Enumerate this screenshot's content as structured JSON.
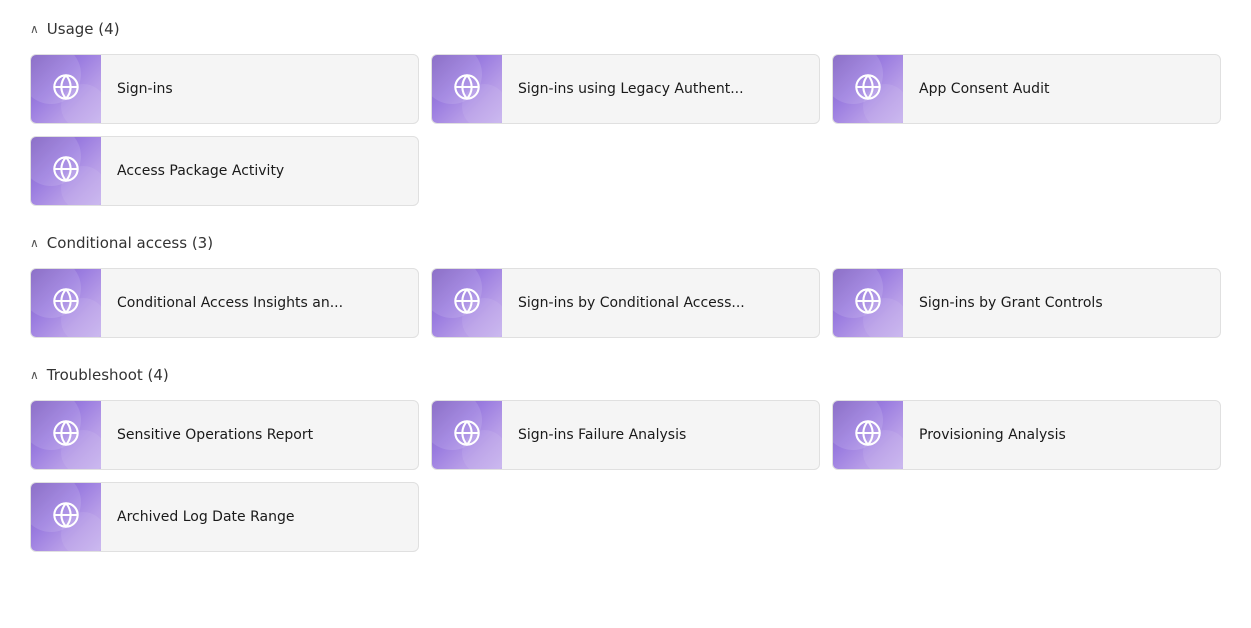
{
  "sections": [
    {
      "id": "usage",
      "label": "Usage (4)",
      "expanded": true,
      "cards": [
        {
          "id": "sign-ins",
          "label": "Sign-ins"
        },
        {
          "id": "sign-ins-legacy",
          "label": "Sign-ins using Legacy Authent..."
        },
        {
          "id": "app-consent-audit",
          "label": "App Consent Audit"
        },
        {
          "id": "access-package-activity",
          "label": "Access Package Activity"
        }
      ]
    },
    {
      "id": "conditional-access",
      "label": "Conditional access (3)",
      "expanded": true,
      "cards": [
        {
          "id": "conditional-access-insights",
          "label": "Conditional Access Insights an..."
        },
        {
          "id": "sign-ins-by-conditional-access",
          "label": "Sign-ins by Conditional Access..."
        },
        {
          "id": "sign-ins-by-grant-controls",
          "label": "Sign-ins by Grant Controls"
        }
      ]
    },
    {
      "id": "troubleshoot",
      "label": "Troubleshoot (4)",
      "expanded": true,
      "cards": [
        {
          "id": "sensitive-operations-report",
          "label": "Sensitive Operations Report"
        },
        {
          "id": "sign-ins-failure-analysis",
          "label": "Sign-ins Failure Analysis"
        },
        {
          "id": "provisioning-analysis",
          "label": "Provisioning Analysis"
        },
        {
          "id": "archived-log-date-range",
          "label": "Archived Log Date Range"
        }
      ]
    }
  ]
}
